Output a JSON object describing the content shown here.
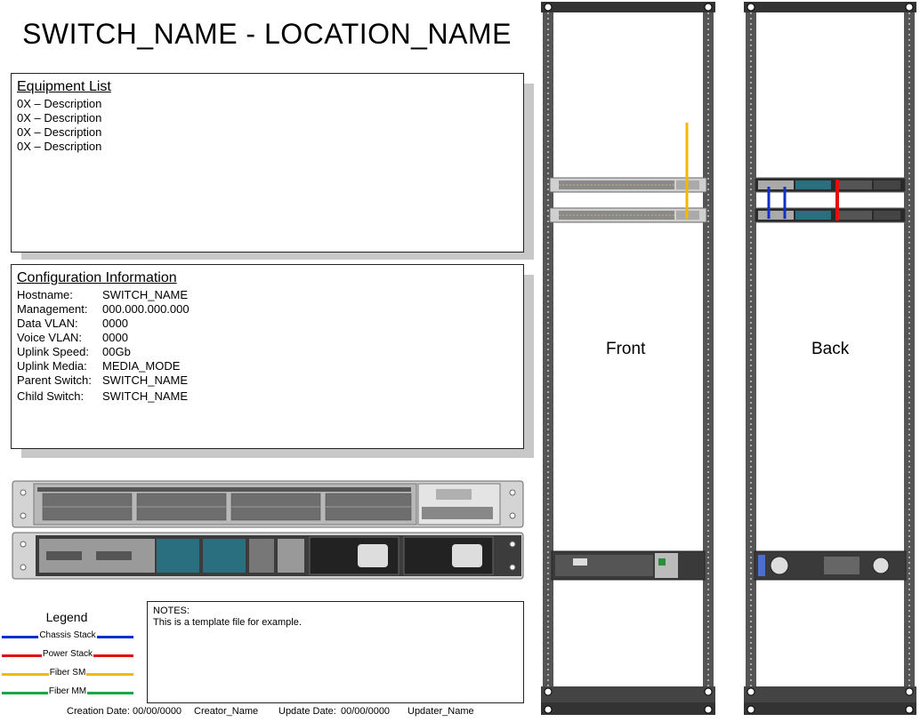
{
  "title": "SWITCH_NAME - LOCATION_NAME",
  "equipment": {
    "heading": "Equipment List",
    "items": [
      "0X  – Description",
      "0X  – Description",
      "0X  – Description",
      "0X  – Description"
    ]
  },
  "config": {
    "heading": "Configuration Information",
    "rows": [
      {
        "key": "Hostname:",
        "value": "SWITCH_NAME"
      },
      {
        "key": "Management:",
        "value": "000.000.000.000"
      },
      {
        "key": "Data VLAN:",
        "value": "0000"
      },
      {
        "key": "Voice VLAN:",
        "value": "0000"
      },
      {
        "key": "Uplink Speed:",
        "value": "00Gb"
      },
      {
        "key": "Uplink Media:",
        "value": "MEDIA_MODE"
      },
      {
        "key": "Parent Switch:",
        "value": "SWITCH_NAME"
      },
      {
        "key": "Child Switch:",
        "value": "SWITCH_NAME"
      }
    ]
  },
  "legend": {
    "title": "Legend",
    "items": [
      {
        "label": "Chassis Stack",
        "color": "#1030c8"
      },
      {
        "label": "Power Stack",
        "color": "#e01010"
      },
      {
        "label": "Fiber SM",
        "color": "#f5b800"
      },
      {
        "label": "Fiber MM",
        "color": "#18a848"
      }
    ]
  },
  "notes": {
    "heading": "NOTES:",
    "text": "This is a template file for example."
  },
  "footer": {
    "creation_label": "Creation Date:",
    "creation_date": "00/00/0000",
    "creator": "Creator_Name",
    "update_label": "Update Date:",
    "update_date": "00/00/0000",
    "updater": "Updater_Name"
  },
  "racks": {
    "front_label": "Front",
    "back_label": "Back"
  }
}
